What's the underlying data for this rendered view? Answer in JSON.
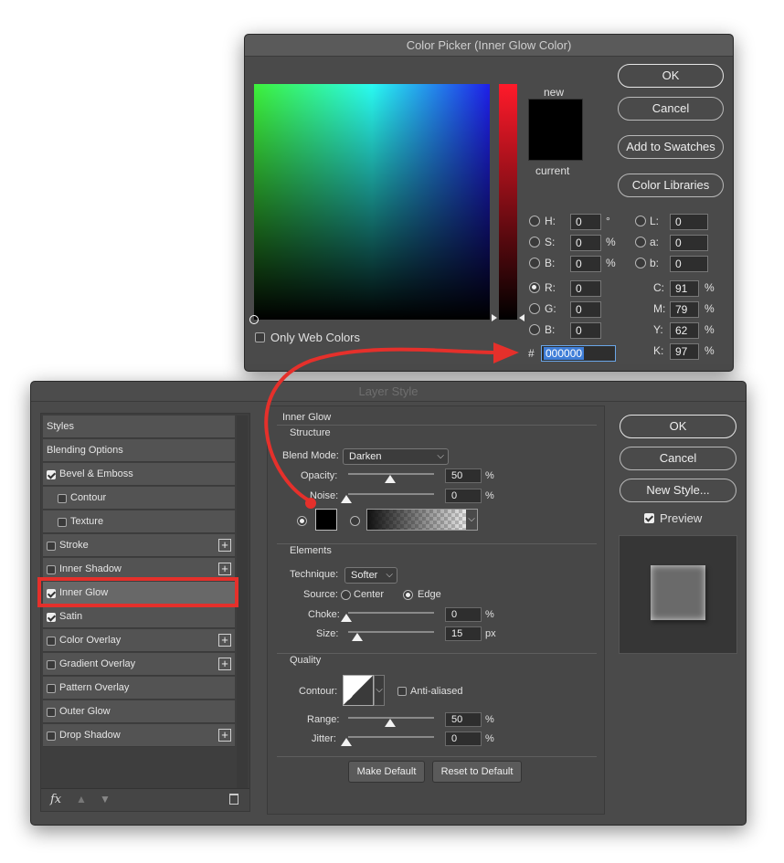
{
  "color_picker": {
    "title": "Color Picker (Inner Glow Color)",
    "buttons": {
      "ok": "OK",
      "cancel": "Cancel",
      "add_to_swatches": "Add to Swatches",
      "color_libraries": "Color Libraries"
    },
    "new_label": "new",
    "current_label": "current",
    "only_web_colors": "Only Web Colors",
    "fields_left": [
      {
        "label": "H:",
        "value": "0",
        "unit": "°",
        "selected": false
      },
      {
        "label": "S:",
        "value": "0",
        "unit": "%",
        "selected": false
      },
      {
        "label": "B:",
        "value": "0",
        "unit": "%",
        "selected": false
      },
      {
        "label": "R:",
        "value": "0",
        "unit": "",
        "selected": true
      },
      {
        "label": "G:",
        "value": "0",
        "unit": "",
        "selected": false
      },
      {
        "label": "B:",
        "value": "0",
        "unit": "",
        "selected": false
      }
    ],
    "fields_lab": [
      {
        "label": "L:",
        "value": "0"
      },
      {
        "label": "a:",
        "value": "0"
      },
      {
        "label": "b:",
        "value": "0"
      }
    ],
    "fields_cmyk": [
      {
        "label": "C:",
        "value": "91",
        "unit": "%"
      },
      {
        "label": "M:",
        "value": "79",
        "unit": "%"
      },
      {
        "label": "Y:",
        "value": "62",
        "unit": "%"
      },
      {
        "label": "K:",
        "value": "97",
        "unit": "%"
      }
    ],
    "hex_label": "#",
    "hex_value": "000000",
    "current_color": "#000000"
  },
  "layer_style": {
    "title": "Layer Style",
    "styles_list": [
      {
        "label": "Styles",
        "checkbox": null,
        "plus": false,
        "indent": false
      },
      {
        "label": "Blending Options",
        "checkbox": null,
        "plus": false,
        "indent": false
      },
      {
        "label": "Bevel & Emboss",
        "checkbox": true,
        "plus": false,
        "indent": false
      },
      {
        "label": "Contour",
        "checkbox": false,
        "plus": false,
        "indent": true
      },
      {
        "label": "Texture",
        "checkbox": false,
        "plus": false,
        "indent": true
      },
      {
        "label": "Stroke",
        "checkbox": false,
        "plus": true,
        "indent": false
      },
      {
        "label": "Inner Shadow",
        "checkbox": false,
        "plus": true,
        "indent": false
      },
      {
        "label": "Inner Glow",
        "checkbox": true,
        "plus": false,
        "indent": false,
        "selected": true
      },
      {
        "label": "Satin",
        "checkbox": true,
        "plus": false,
        "indent": false
      },
      {
        "label": "Color Overlay",
        "checkbox": false,
        "plus": true,
        "indent": false
      },
      {
        "label": "Gradient Overlay",
        "checkbox": false,
        "plus": true,
        "indent": false
      },
      {
        "label": "Pattern Overlay",
        "checkbox": false,
        "plus": false,
        "indent": false
      },
      {
        "label": "Outer Glow",
        "checkbox": false,
        "plus": false,
        "indent": false
      },
      {
        "label": "Drop Shadow",
        "checkbox": false,
        "plus": true,
        "indent": false
      }
    ],
    "fx_label": "fx",
    "panel_title": "Inner Glow",
    "structure": {
      "title": "Structure",
      "blend_mode_label": "Blend Mode:",
      "blend_mode_value": "Darken",
      "opacity_label": "Opacity:",
      "opacity_value": "50",
      "noise_label": "Noise:",
      "noise_value": "0",
      "percent": "%"
    },
    "elements": {
      "title": "Elements",
      "technique_label": "Technique:",
      "technique_value": "Softer",
      "source_label": "Source:",
      "source_center": "Center",
      "source_edge": "Edge",
      "choke_label": "Choke:",
      "choke_value": "0",
      "size_label": "Size:",
      "size_value": "15",
      "size_unit": "px"
    },
    "quality": {
      "title": "Quality",
      "contour_label": "Contour:",
      "anti_aliased": "Anti-aliased",
      "range_label": "Range:",
      "range_value": "50",
      "jitter_label": "Jitter:",
      "jitter_value": "0"
    },
    "make_default": "Make Default",
    "reset_default": "Reset to Default",
    "buttons": {
      "ok": "OK",
      "cancel": "Cancel",
      "new_style": "New Style..."
    },
    "preview_label": "Preview",
    "accent_highlight": "#e5302b"
  }
}
